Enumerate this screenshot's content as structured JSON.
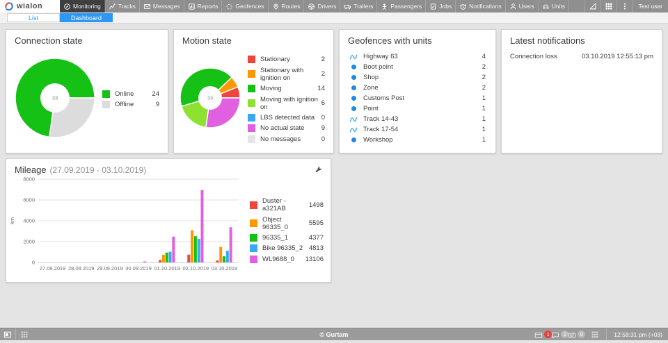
{
  "header": {
    "logo_text": "wialon",
    "user": "Test user",
    "items": [
      {
        "id": "monitoring",
        "label": "Monitoring",
        "active": true
      },
      {
        "id": "tracks",
        "label": "Tracks",
        "active": false
      },
      {
        "id": "messages",
        "label": "Messages",
        "active": false
      },
      {
        "id": "reports",
        "label": "Reports",
        "active": false
      },
      {
        "id": "geofences",
        "label": "Geofences",
        "active": false
      },
      {
        "id": "routes",
        "label": "Routes",
        "active": false
      },
      {
        "id": "drivers",
        "label": "Drivers",
        "active": false
      },
      {
        "id": "trailers",
        "label": "Trailers",
        "active": false
      },
      {
        "id": "passengers",
        "label": "Passengers",
        "active": false
      },
      {
        "id": "jobs",
        "label": "Jobs",
        "active": false
      },
      {
        "id": "notifications",
        "label": "Notifications",
        "active": false
      },
      {
        "id": "users",
        "label": "Users",
        "active": false
      },
      {
        "id": "units",
        "label": "Units",
        "active": false
      }
    ],
    "right_icons": [
      {
        "id": "measure",
        "icon": "ruler-icon"
      },
      {
        "id": "apps",
        "icon": "apps-grid-icon"
      },
      {
        "id": "more",
        "icon": "kebab-menu-icon"
      }
    ]
  },
  "tabs": [
    {
      "id": "list",
      "label": "List",
      "active": false
    },
    {
      "id": "dashboard",
      "label": "Dashboard",
      "active": true
    }
  ],
  "panels": {
    "connection": {
      "title": "Connection state"
    },
    "motion": {
      "title": "Motion state"
    },
    "geofences": {
      "title": "Geofences with units",
      "dot_color": "#1e88e5",
      "line_color": "#4db6f0",
      "rows": [
        {
          "type": "line",
          "label": "Highway 63",
          "value": "4"
        },
        {
          "type": "area",
          "label": "Boot point",
          "value": "2"
        },
        {
          "type": "area",
          "label": "Shop",
          "value": "2"
        },
        {
          "type": "area",
          "label": "Zone",
          "value": "2"
        },
        {
          "type": "area",
          "label": "Customs Post",
          "value": "1"
        },
        {
          "type": "area",
          "label": "Point",
          "value": "1"
        },
        {
          "type": "line",
          "label": "Track 14-43",
          "value": "1"
        },
        {
          "type": "line",
          "label": "Track 17-54",
          "value": "1"
        },
        {
          "type": "area",
          "label": "Workshop",
          "value": "1"
        }
      ]
    },
    "notifications": {
      "title": "Latest notifications",
      "rows": [
        {
          "label": "Connection loss",
          "time": "03.10.2019 12:55:13 pm"
        }
      ]
    },
    "mileage": {
      "title": "Mileage",
      "subtitle": "(27.09.2019 - 03.10.2019)"
    }
  },
  "chart_data": [
    {
      "type": "donut",
      "name": "connection-state",
      "center_label": "33",
      "total": 33,
      "legend_position": "right",
      "segments": [
        {
          "label": "Online",
          "value": 24,
          "color": "#15c115"
        },
        {
          "label": "Offline",
          "value": 9,
          "color": "#dcdcdc"
        }
      ]
    },
    {
      "type": "donut",
      "name": "motion-state",
      "center_label": "33",
      "total": 33,
      "legend_position": "right",
      "segments": [
        {
          "label": "Stationary",
          "value": 2,
          "color": "#f0453b"
        },
        {
          "label": "Stationary with ignition on",
          "value": 2,
          "color": "#ff9800"
        },
        {
          "label": "Moving",
          "value": 14,
          "color": "#15c115"
        },
        {
          "label": "Moving with ignition on",
          "value": 6,
          "color": "#8ce22e"
        },
        {
          "label": "LBS detected data",
          "value": 0,
          "color": "#39a9f3"
        },
        {
          "label": "No actual state",
          "value": 9,
          "color": "#e060e0"
        },
        {
          "label": "No messages",
          "value": 0,
          "color": "#e4e4e4"
        }
      ]
    },
    {
      "type": "bar",
      "name": "mileage",
      "title": "Mileage (27.09.2019 - 03.10.2019)",
      "xlabel": "",
      "ylabel": "km",
      "ylim": [
        0,
        8000
      ],
      "yticks": [
        0,
        2000,
        4000,
        6000,
        8000
      ],
      "grid": true,
      "legend_position": "right",
      "categories": [
        "27.09.2019",
        "28.09.2019",
        "29.09.2019",
        "30.09.2019",
        "01.10.2019",
        "02.10.2019",
        "03.10.2019"
      ],
      "series": [
        {
          "name": "Duster - a321AB",
          "color": "#f0453b",
          "total": 1498,
          "values": [
            0,
            0,
            0,
            0,
            230,
            750,
            190
          ]
        },
        {
          "name": "Object 96335_0",
          "color": "#ff9800",
          "total": 5595,
          "values": [
            0,
            0,
            0,
            0,
            740,
            3100,
            1490
          ]
        },
        {
          "name": "96335_1",
          "color": "#15c115",
          "total": 4377,
          "values": [
            0,
            0,
            0,
            0,
            950,
            2520,
            590
          ]
        },
        {
          "name": "Bike 96335_2",
          "color": "#39a9f3",
          "total": 4813,
          "values": [
            0,
            0,
            0,
            0,
            1030,
            2270,
            1120
          ]
        },
        {
          "name": "WL9688_0",
          "color": "#e060e0",
          "total": 13106,
          "values": [
            0,
            0,
            0,
            100,
            2480,
            6950,
            3380
          ]
        }
      ]
    }
  ],
  "footer": {
    "copyright": "© Gurtam",
    "time": "12:58:31 pm (+03)",
    "badge_red": "#e8413c",
    "badge_gray": "#b9b9b9",
    "badges": [
      {
        "icon": "notification-window-icon",
        "count": "1",
        "alert": true
      },
      {
        "icon": "chat-icon",
        "count": "0",
        "alert": false
      },
      {
        "icon": "sms-icon",
        "count": "0",
        "alert": false
      }
    ]
  }
}
